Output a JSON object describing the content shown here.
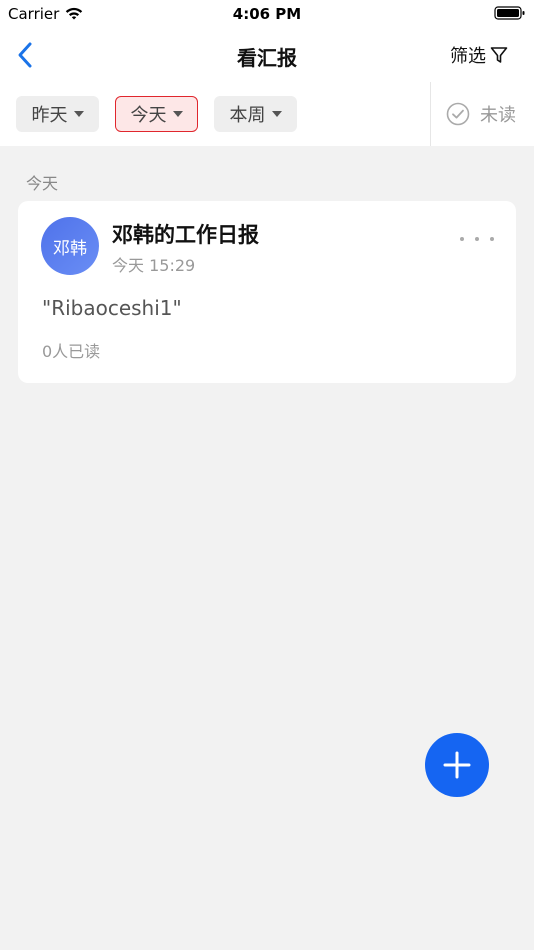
{
  "status_bar": {
    "carrier": "Carrier",
    "time": "4:06 PM"
  },
  "nav": {
    "title": "看汇报",
    "filter_label": "筛选",
    "accent_color": "#1a73e8"
  },
  "filters": {
    "chips": [
      {
        "label": "昨天",
        "active": false
      },
      {
        "label": "今天",
        "active": true
      },
      {
        "label": "本周",
        "active": false
      }
    ],
    "unread_label": "未读",
    "active_color": "#e0262d"
  },
  "section": {
    "label": "今天"
  },
  "report": {
    "avatar_text": "邓韩",
    "title": "邓韩的工作日报",
    "time": "今天 15:29",
    "content": "\"Ribaoceshi1\"",
    "read_count": "0人已读"
  },
  "fab": {
    "icon": "plus-icon",
    "color": "#1565f2"
  }
}
